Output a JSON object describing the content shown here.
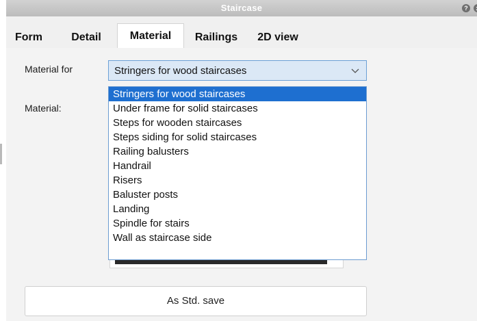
{
  "window": {
    "title": "Staircase",
    "help_glyph": "?",
    "close_glyph": "x"
  },
  "tabs": [
    {
      "label": "Form",
      "active": false
    },
    {
      "label": "Detail",
      "active": false
    },
    {
      "label": "Material",
      "active": true
    },
    {
      "label": "Railings",
      "active": false
    },
    {
      "label": "2D view",
      "active": false
    }
  ],
  "form": {
    "material_for_label": "Material for",
    "material_label": "Material:",
    "selected_value": "Stringers for wood staircases",
    "options": [
      "Stringers for wood staircases",
      "Under frame for solid staircases",
      "Steps for wooden staircases",
      "Steps siding for solid staircases",
      "Railing balusters",
      "Handrail",
      "Risers",
      "Baluster posts",
      "Landing",
      "Spindle for stairs",
      "Wall as staircase side"
    ],
    "selected_index": 0
  },
  "buttons": {
    "std_save": "As Std. save"
  }
}
